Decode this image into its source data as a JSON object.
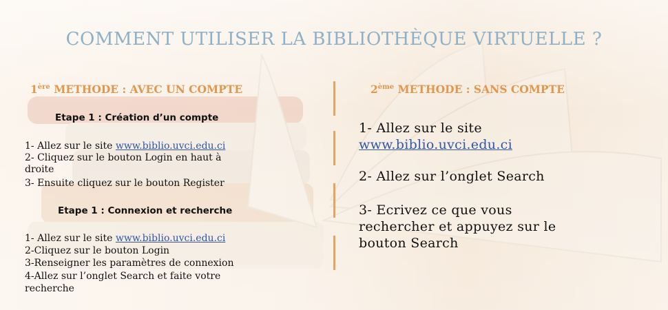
{
  "title": "COMMENT UTILISER LA BIBLIOTHÈQUE VIRTUELLE ?",
  "left": {
    "heading": {
      "num": "1",
      "sup": "ère",
      "text": " METHODE : AVEC UN COMPTE"
    },
    "etape1": {
      "title": "Etape 1 : Création d’un compte",
      "steps": [
        {
          "prefix": "1- Allez sur le site ",
          "link": "www.biblio.uvci.edu.ci"
        },
        {
          "text": "2- Cliquez sur le bouton Login en haut à"
        },
        {
          "text": "droite"
        },
        {
          "text": "3- Ensuite cliquez sur le bouton Register"
        }
      ]
    },
    "etape2": {
      "title": "Etape 1 : Connexion et recherche",
      "steps": [
        {
          "prefix": "1- Allez sur le site ",
          "link": "www.biblio.uvci.edu.ci"
        },
        {
          "text": "2-Cliquez sur le bouton Login"
        },
        {
          "text": "3-Renseigner les paramètres de connexion"
        },
        {
          "text": "4-Allez sur l’onglet Search et faite votre"
        },
        {
          "text": "recherche"
        }
      ]
    }
  },
  "right": {
    "heading": {
      "num": "2",
      "sup": "ème",
      "text": " METHODE : SANS COMPTE"
    },
    "steps": [
      {
        "text": "1- Allez sur le site"
      },
      {
        "link": "www.biblio.uvci.edu.ci"
      },
      {
        "text": "2- Allez sur l’onglet Search"
      },
      {
        "text": "3- Ecrivez ce que vous"
      },
      {
        "text": "rechercher et appuyez sur le"
      },
      {
        "text": "bouton Search"
      }
    ]
  },
  "colors": {
    "title": "#8fb0c6",
    "heading": "#e3974c",
    "link": "#2f57a5",
    "divider": "#e2a564"
  }
}
